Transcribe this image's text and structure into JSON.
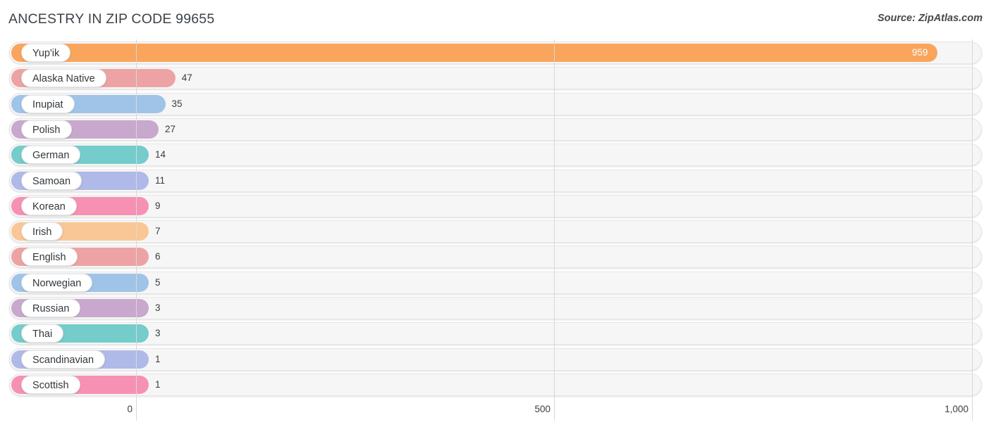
{
  "header": {
    "title": "ANCESTRY IN ZIP CODE 99655",
    "source": "Source: ZipAtlas.com"
  },
  "chart_data": {
    "type": "bar",
    "orientation": "horizontal",
    "title": "ANCESTRY IN ZIP CODE 99655",
    "subtitle": "Source: ZipAtlas.com",
    "xlabel": "",
    "ylabel": "",
    "xlim": [
      0,
      1000
    ],
    "xticks": [
      0,
      500,
      1000
    ],
    "xtick_labels": [
      "0",
      "500",
      "1,000"
    ],
    "grid": true,
    "legend": false,
    "categories": [
      "Yup'ik",
      "Alaska Native",
      "Inupiat",
      "Polish",
      "German",
      "Samoan",
      "Korean",
      "Irish",
      "English",
      "Norwegian",
      "Russian",
      "Thai",
      "Scandinavian",
      "Scottish"
    ],
    "values": [
      959,
      47,
      35,
      27,
      14,
      11,
      9,
      7,
      6,
      5,
      3,
      3,
      1,
      1
    ],
    "value_labels": [
      "959",
      "47",
      "35",
      "27",
      "14",
      "11",
      "9",
      "7",
      "6",
      "5",
      "3",
      "3",
      "1",
      "1"
    ],
    "colors": [
      "#f9a55c",
      "#eda3a3",
      "#a0c4e8",
      "#c9a8ce",
      "#74cccb",
      "#b0bae8",
      "#f791b3",
      "#f9c795",
      "#eda3a3",
      "#a0c4e8",
      "#c9a8ce",
      "#74cccb",
      "#b0bae8",
      "#f791b3"
    ]
  },
  "style": {
    "track_color": "#f6f6f6",
    "gridline_color": "#d8d8d8",
    "title_color": "#3d4349",
    "value_text_color": "#3c3c3c",
    "inside_value_text_color": "#ffffff"
  }
}
